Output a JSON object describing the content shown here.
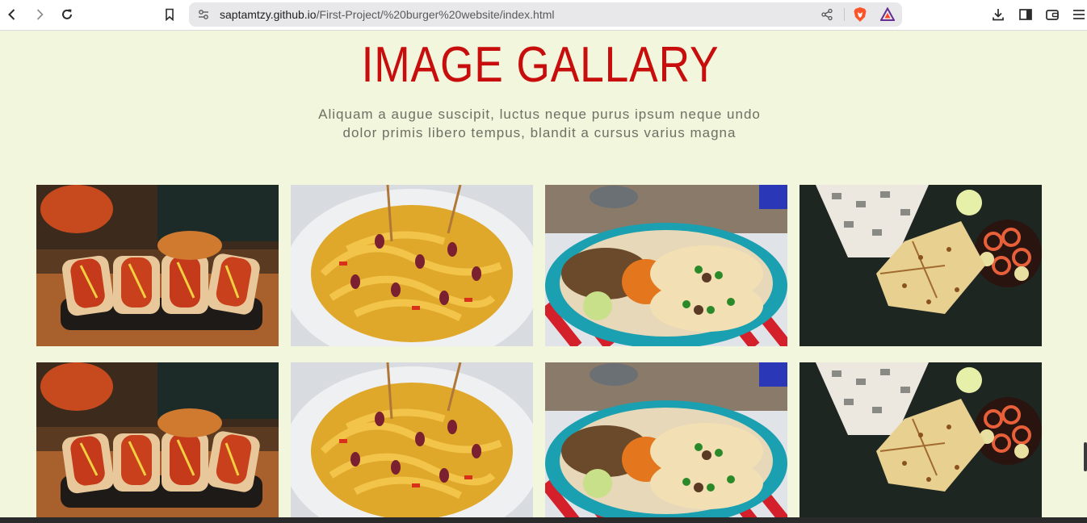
{
  "browser": {
    "url_host": "saptamtzy.github.io",
    "url_path": "/First-Project/%20burger%20website/index.html",
    "icons": [
      "back-icon",
      "forward-icon",
      "reload-icon",
      "bookmark-icon",
      "site-settings-icon",
      "share-icon",
      "brave-shields-icon",
      "brave-rewards-icon",
      "downloads-icon",
      "sidebar-icon",
      "wallet-icon",
      "menu-icon"
    ]
  },
  "gallery": {
    "title": "IMAGE GALLARY",
    "subtitle": "Aliquam a augue suscipit, luctus neque purus ipsum neque undo dolor primis libero tempus, blandit a cursus varius magna",
    "images": [
      "hot-dogs",
      "pasta",
      "tacos",
      "naan",
      "hot-dogs",
      "pasta",
      "tacos",
      "naan"
    ]
  },
  "colors": {
    "page_bg": "#f2f6dc",
    "title": "#c80d0d",
    "subtitle": "#6f6f66"
  }
}
